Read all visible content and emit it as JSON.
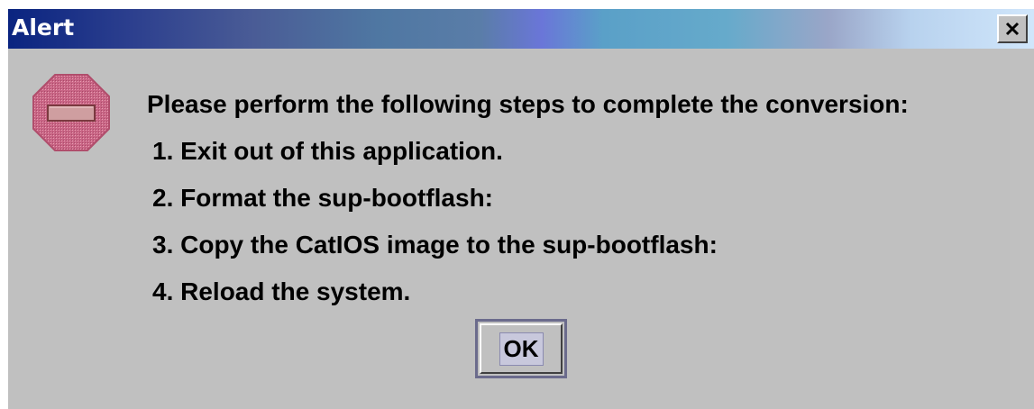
{
  "window": {
    "title": "Alert",
    "close_label": "X"
  },
  "icon": {
    "name": "stop-sign-icon",
    "color": "#c0607a"
  },
  "message": {
    "intro": "Please perform the following steps to complete the conversion:",
    "steps": [
      "1. Exit out of this application.",
      "2. Format the sup-bootflash:",
      "3. Copy the CatIOS image to the sup-bootflash:",
      "4. Reload the system."
    ]
  },
  "buttons": {
    "ok_label": "OK"
  }
}
